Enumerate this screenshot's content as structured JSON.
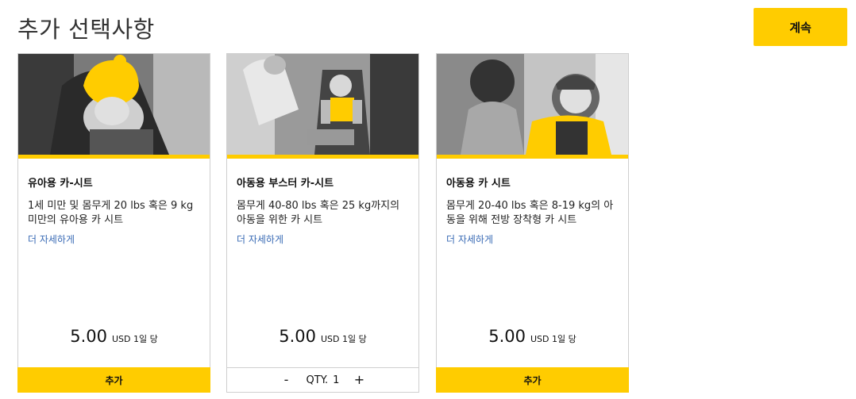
{
  "header": {
    "title": "추가 선택사항",
    "continue_label": "계속"
  },
  "colors": {
    "accent": "#ffcc00",
    "link": "#3a6bb5",
    "border": "#cfcfcf"
  },
  "cards": [
    {
      "title": "유아용 카-시트",
      "description": "1세 미만 및 몸무게 20 lbs 혹은 9 kg 미만의 유아용 카 시트",
      "link": "더 자세하게",
      "price": "5.00",
      "price_unit": "USD 1일 당",
      "action": "추가"
    },
    {
      "title": "아동용 부스터 카-시트",
      "description": "몸무게 40-80 lbs 혹은 25 kg까지의 아동을 위한 카 시트",
      "link": "더 자세하게",
      "price": "5.00",
      "price_unit": "USD 1일 당",
      "qty_minus": "-",
      "qty_label": "QTY.",
      "qty_value": "1",
      "qty_plus": "+"
    },
    {
      "title": "아동용 카 시트",
      "description": "몸무게 20-40 lbs 혹은 8-19 kg의 아동을 위해 전방 장착형 카 시트",
      "link": "더 자세하게",
      "price": "5.00",
      "price_unit": "USD 1일 당",
      "action": "추가"
    }
  ]
}
